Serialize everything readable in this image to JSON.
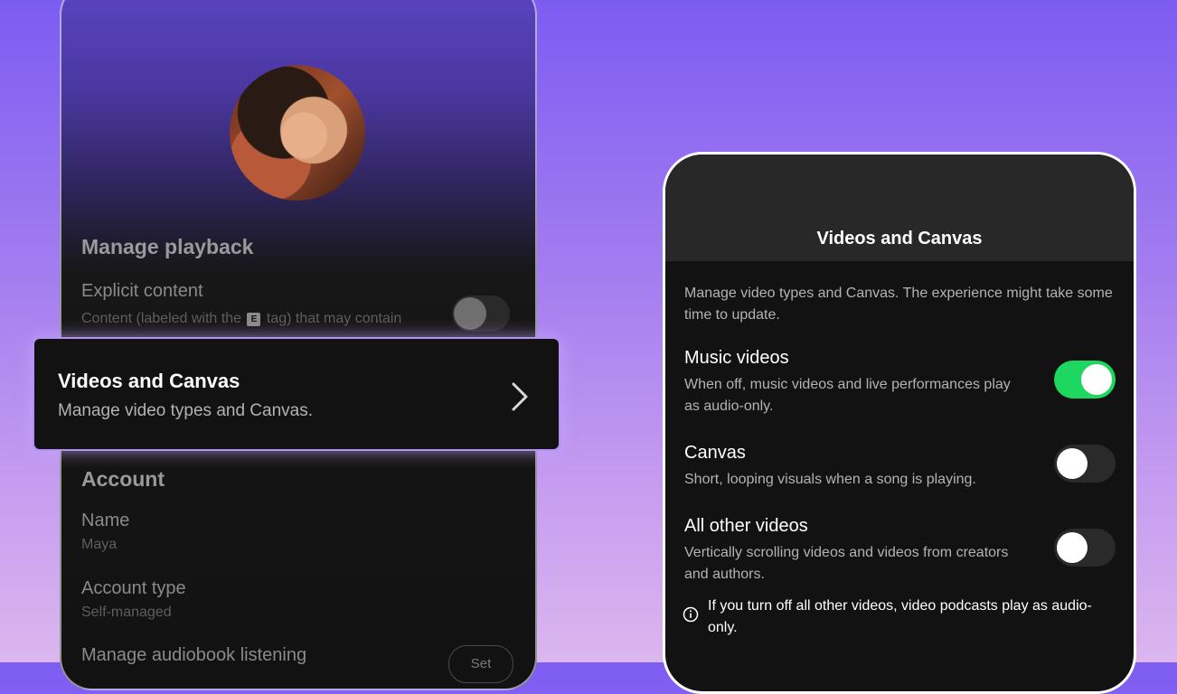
{
  "left_phone": {
    "manage_playback_title": "Manage playback",
    "explicit_content": {
      "title": "Explicit content",
      "desc_before": "Content (labeled with the",
      "tag": "E",
      "desc_after": "tag) that may contain",
      "enabled": false
    },
    "account_title": "Account",
    "name": {
      "label": "Name",
      "value": "Maya"
    },
    "account_type": {
      "label": "Account type",
      "value": "Self-managed"
    },
    "audiobook": {
      "label": "Manage audiobook listening",
      "button_label": "Set"
    }
  },
  "highlight": {
    "title": "Videos and Canvas",
    "subtitle": "Manage video types and Canvas."
  },
  "right_phone": {
    "header_title": "Videos and Canvas",
    "intro": "Manage video types and Canvas. The experience might take some time to update.",
    "settings": [
      {
        "title": "Music videos",
        "desc": "When off, music videos and live performances play as audio-only.",
        "enabled": true
      },
      {
        "title": "Canvas",
        "desc": "Short, looping visuals when a song is playing.",
        "enabled": false
      },
      {
        "title": "All other videos",
        "desc": "Vertically scrolling videos and videos from creators and authors.",
        "enabled": false
      }
    ],
    "info_note": "If you turn off all other videos, video podcasts play as audio-only."
  },
  "colors": {
    "toggle_on": "#1ed760",
    "highlight_border": "#b490f7",
    "background_top": "#7d5cf2",
    "background_bottom": "#dcb6ee"
  }
}
